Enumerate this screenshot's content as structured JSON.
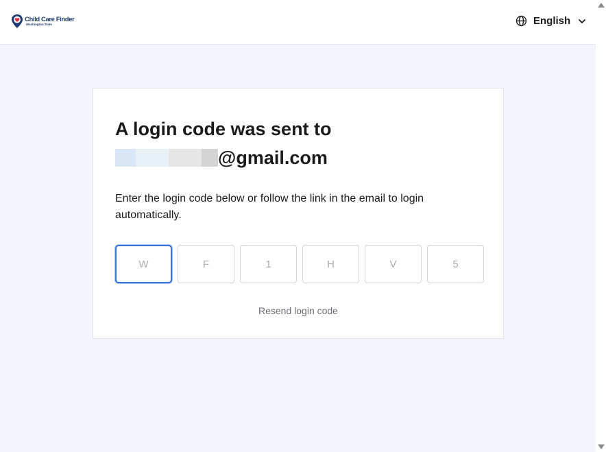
{
  "header": {
    "logo": {
      "title": "Child Care Finder",
      "subtitle": "Washington State"
    },
    "language": {
      "icon": "globe-icon",
      "label": "English",
      "dropdown_icon": "chevron-down-icon"
    }
  },
  "card": {
    "heading_line1": "A login code was sent to",
    "email_domain": "@gmail.com",
    "instructions": "Enter the login code below or follow the link in the email to login automatically.",
    "code_placeholders": [
      "W",
      "F",
      "1",
      "H",
      "V",
      "5"
    ],
    "resend_label": "Resend login code"
  },
  "colors": {
    "brand": "#1f3b73",
    "accent": "#3c73d6",
    "background": "#f2f5fa"
  }
}
